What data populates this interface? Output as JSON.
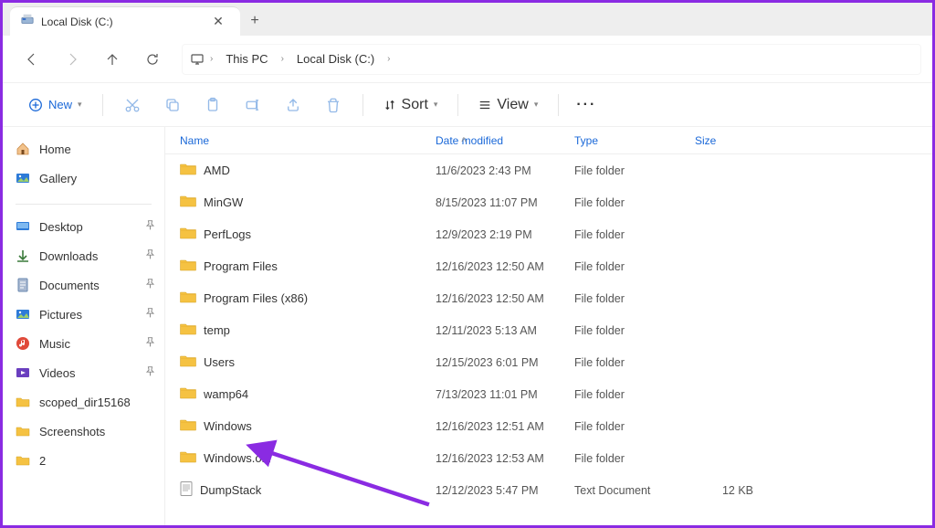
{
  "tab": {
    "title": "Local Disk (C:)"
  },
  "breadcrumb": [
    "This PC",
    "Local Disk (C:)"
  ],
  "toolbar": {
    "new": "New",
    "sort": "Sort",
    "view": "View"
  },
  "sidebar": {
    "top": [
      {
        "label": "Home",
        "icon": "home"
      },
      {
        "label": "Gallery",
        "icon": "gallery"
      }
    ],
    "pinned": [
      {
        "label": "Desktop",
        "icon": "desktop"
      },
      {
        "label": "Downloads",
        "icon": "downloads"
      },
      {
        "label": "Documents",
        "icon": "documents"
      },
      {
        "label": "Pictures",
        "icon": "pictures"
      },
      {
        "label": "Music",
        "icon": "music"
      },
      {
        "label": "Videos",
        "icon": "videos"
      },
      {
        "label": "scoped_dir15168",
        "icon": "folder"
      },
      {
        "label": "Screenshots",
        "icon": "folder"
      },
      {
        "label": "2",
        "icon": "folder"
      }
    ]
  },
  "columns": {
    "name": "Name",
    "date": "Date modified",
    "type": "Type",
    "size": "Size"
  },
  "rows": [
    {
      "name": "AMD",
      "date": "11/6/2023 2:43 PM",
      "type": "File folder",
      "size": "",
      "icon": "folder"
    },
    {
      "name": "MinGW",
      "date": "8/15/2023 11:07 PM",
      "type": "File folder",
      "size": "",
      "icon": "folder"
    },
    {
      "name": "PerfLogs",
      "date": "12/9/2023 2:19 PM",
      "type": "File folder",
      "size": "",
      "icon": "folder"
    },
    {
      "name": "Program Files",
      "date": "12/16/2023 12:50 AM",
      "type": "File folder",
      "size": "",
      "icon": "folder"
    },
    {
      "name": "Program Files (x86)",
      "date": "12/16/2023 12:50 AM",
      "type": "File folder",
      "size": "",
      "icon": "folder"
    },
    {
      "name": "temp",
      "date": "12/11/2023 5:13 AM",
      "type": "File folder",
      "size": "",
      "icon": "folder"
    },
    {
      "name": "Users",
      "date": "12/15/2023 6:01 PM",
      "type": "File folder",
      "size": "",
      "icon": "folder"
    },
    {
      "name": "wamp64",
      "date": "7/13/2023 11:01 PM",
      "type": "File folder",
      "size": "",
      "icon": "folder"
    },
    {
      "name": "Windows",
      "date": "12/16/2023 12:51 AM",
      "type": "File folder",
      "size": "",
      "icon": "folder"
    },
    {
      "name": "Windows.old",
      "date": "12/16/2023 12:53 AM",
      "type": "File folder",
      "size": "",
      "icon": "folder"
    },
    {
      "name": "DumpStack",
      "date": "12/12/2023 5:47 PM",
      "type": "Text Document",
      "size": "12 KB",
      "icon": "text"
    }
  ],
  "annotation": {
    "target": "Windows"
  },
  "colors": {
    "accent": "#1a68d8",
    "arrow": "#8a2be2",
    "folder": "#f5c242"
  }
}
